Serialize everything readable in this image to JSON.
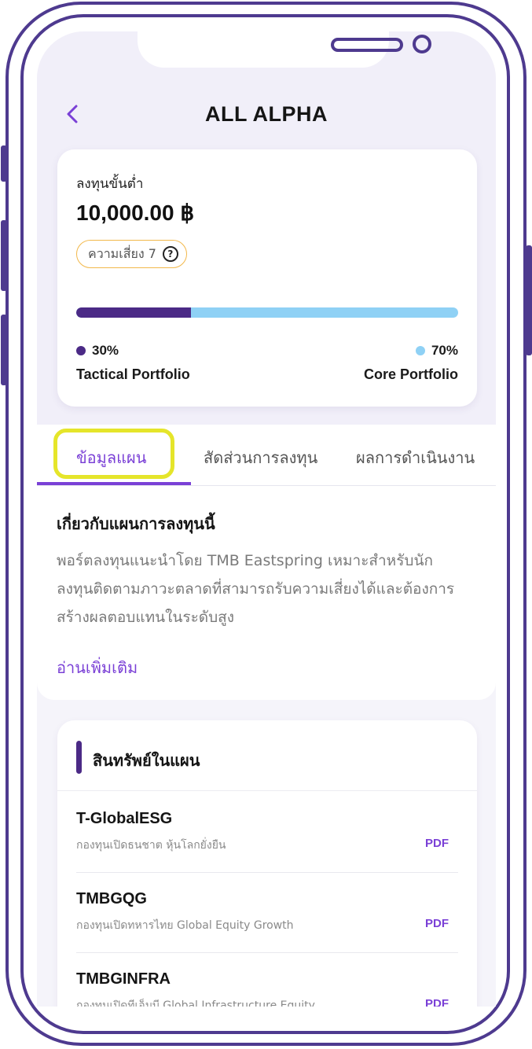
{
  "header": {
    "title": "ALL ALPHA"
  },
  "summary": {
    "min_label": "ลงทุนขั้นต่ำ",
    "min_value": "10,000.00 ฿",
    "risk_label": "ความเสี่ยง 7",
    "allocation": [
      {
        "percent_label": "30%",
        "name": "Tactical Portfolio",
        "fraction": 0.3,
        "color": "#4b2a86"
      },
      {
        "percent_label": "70%",
        "name": "Core Portfolio",
        "fraction": 0.7,
        "color": "#8fd1f5"
      }
    ]
  },
  "tabs": [
    {
      "label": "ข้อมูลแผน",
      "active": true
    },
    {
      "label": "สัดส่วนการลงทุน",
      "active": false
    },
    {
      "label": "ผลการดำเนินงาน",
      "active": false
    }
  ],
  "about": {
    "title": "เกี่ยวกับแผนการลงทุนนี้",
    "body": "พอร์ตลงทุนแนะนำโดย TMB Eastspring เหมาะสำหรับนักลงทุนติดตามภาวะตลาดที่สามารถรับความเสี่ยงได้และต้องการสร้างผลตอบแทนในระดับสูง",
    "read_more": "อ่านเพิ่มเติม"
  },
  "assets": {
    "title": "สินทรัพย์ในแผน",
    "funds": [
      {
        "name": "T-GlobalESG",
        "desc": "กองทุนเปิดธนชาต หุ้นโลกยั่งยืน",
        "link": "PDF"
      },
      {
        "name": "TMBGQG",
        "desc": "กองทุนเปิดทหารไทย Global Equity Growth",
        "link": "PDF"
      },
      {
        "name": "TMBGINFRA",
        "desc": "กองทุนเปิดทีเอ็มบี Global Infrastructure Equity",
        "link": "PDF"
      }
    ]
  },
  "colors": {
    "frame": "#4e3a8f",
    "accent": "#7a40d6",
    "highlight": "#e5e52a",
    "badge_border": "#f2b84b"
  },
  "icons": {
    "back": "chevron-left-icon",
    "help": "question-circle-icon"
  }
}
